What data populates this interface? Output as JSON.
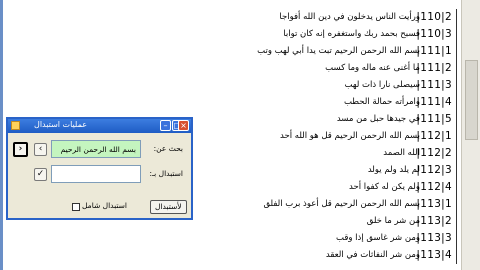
{
  "rows": [
    {
      "num": "|110|2",
      "text": "ورأيت الناس يدخلون في دين الله أفواجا"
    },
    {
      "num": "|110|3",
      "text": "فسبح بحمد ربك واستغفره إنه كان توابا"
    },
    {
      "num": "|111|1",
      "text": "بسم الله الرحمن الرحيم تبت يدا أبي لهب وتب"
    },
    {
      "num": "|111|2",
      "text": "ما أغنى عنه ماله وما كسب"
    },
    {
      "num": "|111|3",
      "text": "سيصلى نارا ذات لهب"
    },
    {
      "num": "|111|4",
      "text": "وامرأته حمالة الحطب"
    },
    {
      "num": "|111|5",
      "text": "في جيدها حبل من مسد"
    },
    {
      "num": "|112|1",
      "text": "بسم الله الرحمن الرحيم قل هو الله أحد"
    },
    {
      "num": "|112|2",
      "text": "الله الصمد"
    },
    {
      "num": "|112|3",
      "text": "لم يلد ولم يولد"
    },
    {
      "num": "|112|4",
      "text": "ولم يكن له كفوا أحد"
    },
    {
      "num": "|113|1",
      "text": "بسم الله الرحمن الرحيم قل أعوذ برب الفلق"
    },
    {
      "num": "|113|2",
      "text": "من شر ما خلق"
    },
    {
      "num": "|113|3",
      "text": "ومن شر غاسق إذا وقب"
    },
    {
      "num": "|113|4",
      "text": "ومن شر النفاثات في العقد"
    }
  ],
  "dialog": {
    "title": "عمليات استبدال",
    "find_label": "بحث عن:",
    "find_value": "بسم الله الرحمن الرحيم",
    "replace_label": "استبدال بـ:",
    "replace_value": "",
    "whole_word_label": "استبدال شامل",
    "button_label": "لأستبدال"
  }
}
